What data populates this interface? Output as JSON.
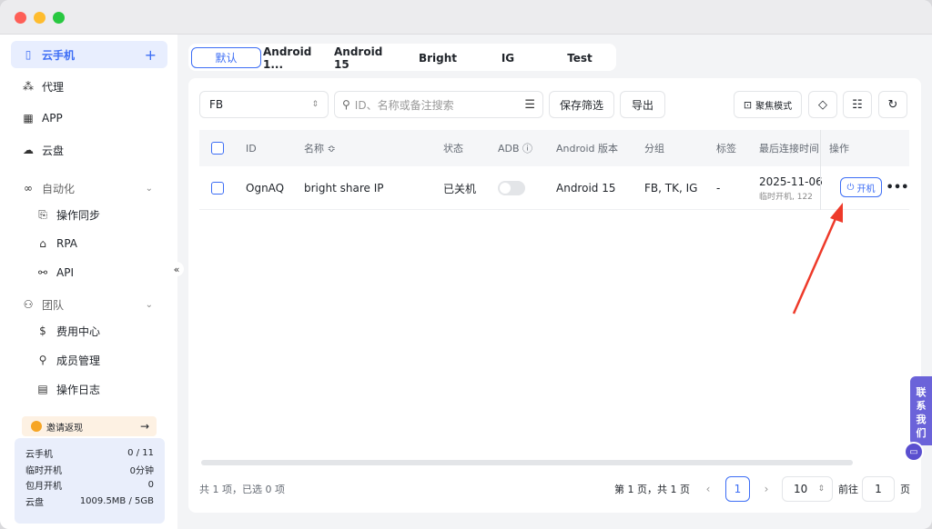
{
  "sidebar": {
    "items": [
      {
        "label": "云手机",
        "icon": "phone-icon"
      },
      {
        "label": "代理",
        "icon": "proxy-icon"
      },
      {
        "label": "APP",
        "icon": "grid-icon"
      },
      {
        "label": "云盘",
        "icon": "cloud-icon"
      }
    ],
    "add_label": "+",
    "automation": {
      "label": "自动化",
      "items": [
        {
          "label": "操作同步"
        },
        {
          "label": "RPA"
        },
        {
          "label": "API"
        }
      ]
    },
    "team": {
      "label": "团队",
      "items": [
        {
          "label": "费用中心"
        },
        {
          "label": "成员管理"
        },
        {
          "label": "操作日志"
        }
      ]
    },
    "invite": {
      "label": "邀请返现",
      "arrow": "→"
    },
    "usage": [
      {
        "label": "云手机",
        "value": "0 / 11"
      },
      {
        "label": "临时开机",
        "value": "0分钟"
      },
      {
        "label": "包月开机",
        "value": "0"
      },
      {
        "label": "云盘",
        "value": "1009.5MB / 5GB"
      }
    ],
    "collapse_glyph": "«"
  },
  "tabs": [
    {
      "label": "默认",
      "active": true
    },
    {
      "label": "Android 1..."
    },
    {
      "label": "Android 15"
    },
    {
      "label": "Bright"
    },
    {
      "label": "IG"
    },
    {
      "label": "Test"
    }
  ],
  "toolbar": {
    "group_select": "FB",
    "search_placeholder": "ID、名称或备注搜索",
    "save_filter": "保存筛选",
    "export": "导出",
    "focus_mode": "聚焦模式"
  },
  "table": {
    "headers": {
      "id": "ID",
      "name": "名称 ≎",
      "status": "状态",
      "adb": "ADB ⓘ",
      "android": "Android 版本",
      "group": "分组",
      "tag": "标签",
      "last_conn": "最后连接时间",
      "ops": "操作"
    },
    "rows": [
      {
        "id": "OgnAQ",
        "name": "bright share IP",
        "status": "已关机",
        "adb_on": false,
        "android": "Android 15",
        "group": "FB, TK, IG",
        "tag": "-",
        "last_date": "2025-11-06",
        "last_sub": "临时开机, 122",
        "power": "开机",
        "more": "•••"
      }
    ]
  },
  "footer": {
    "summary": "共 1 项，已选 0 项",
    "page_info": "第 1 页，共 1 页",
    "prev": "‹",
    "current_page": "1",
    "next": "›",
    "page_size": "10",
    "goto_label": "前往",
    "goto_value": "1",
    "page_suffix": "页"
  },
  "contact": {
    "label": "联系我们",
    "chars": [
      "联",
      "系",
      "我",
      "们"
    ]
  },
  "colors": {
    "accent": "#3d6ef5",
    "annotation": "#ee3a2a",
    "contact": "#6b63d9"
  }
}
